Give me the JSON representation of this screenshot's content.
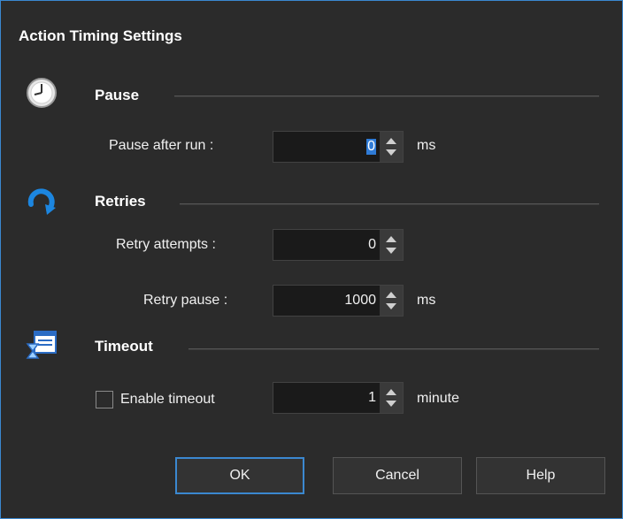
{
  "dialog": {
    "title": "Action Timing Settings"
  },
  "pause": {
    "title": "Pause",
    "icon": "clock-icon",
    "label": "Pause after run :",
    "value": "0",
    "unit": "ms"
  },
  "retries": {
    "title": "Retries",
    "icon": "retry-arrow-icon",
    "attempts_label": "Retry attempts :",
    "attempts_value": "0",
    "pause_label": "Retry pause :",
    "pause_value": "1000",
    "pause_unit": "ms"
  },
  "timeout": {
    "title": "Timeout",
    "icon": "hourglass-window-icon",
    "checkbox_label": "Enable timeout",
    "checked": false,
    "value": "1",
    "unit": "minute"
  },
  "buttons": {
    "ok": "OK",
    "cancel": "Cancel",
    "help": "Help"
  },
  "colors": {
    "accent": "#3b88d0",
    "background": "#2b2b2b",
    "field": "#1a1a1a"
  }
}
